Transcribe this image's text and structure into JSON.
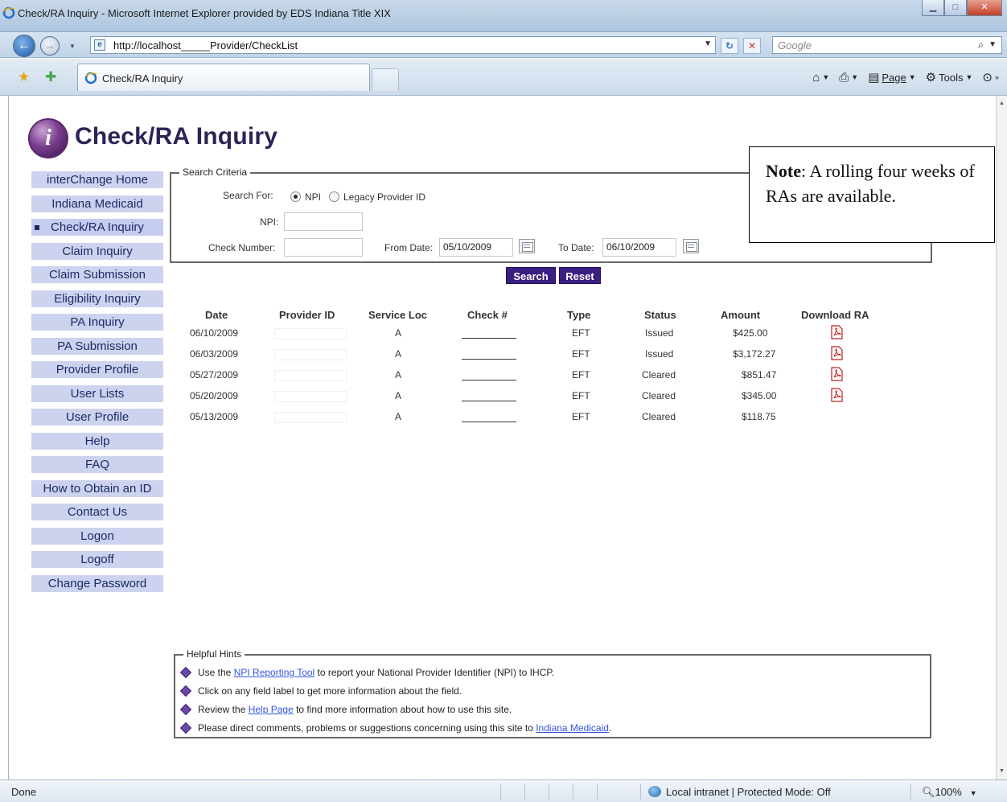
{
  "window": {
    "title": "Check/RA Inquiry - Microsoft Internet Explorer provided by EDS Indiana Title XIX"
  },
  "address_bar": {
    "url": "http://localhost_____Provider/CheckList",
    "search_placeholder": "Google"
  },
  "tab": {
    "label": "Check/RA Inquiry"
  },
  "command_bar": {
    "page_label": "Page",
    "tools_label": "Tools"
  },
  "page": {
    "heading": "Check/RA Inquiry",
    "logo_glyph": "i"
  },
  "nav": [
    {
      "label": "interChange Home"
    },
    {
      "label": "Indiana Medicaid"
    },
    {
      "label": "Check/RA Inquiry",
      "active": true
    },
    {
      "label": "Claim Inquiry"
    },
    {
      "label": "Claim Submission"
    },
    {
      "label": "Eligibility Inquiry"
    },
    {
      "label": "PA Inquiry"
    },
    {
      "label": "PA Submission"
    },
    {
      "label": "Provider Profile"
    },
    {
      "label": "User Lists"
    },
    {
      "label": "User Profile"
    },
    {
      "label": "Help"
    },
    {
      "label": "FAQ"
    },
    {
      "label": "How to Obtain an ID"
    },
    {
      "label": "Contact Us"
    },
    {
      "label": "Logon"
    },
    {
      "label": "Logoff"
    },
    {
      "label": "Change Password"
    }
  ],
  "search_criteria": {
    "legend": "Search Criteria",
    "search_for_label": "Search For:",
    "options": [
      {
        "label": "NPI",
        "selected": true
      },
      {
        "label": "Legacy Provider ID",
        "selected": false
      }
    ],
    "npi_label": "NPI:",
    "npi_value": "",
    "check_number_label": "Check Number:",
    "check_number_value": "",
    "from_date_label": "From Date:",
    "from_date_value": "05/10/2009",
    "to_date_label": "To Date:",
    "to_date_value": "06/10/2009"
  },
  "buttons": {
    "search": "Search",
    "reset": "Reset"
  },
  "results": {
    "columns": [
      "Date",
      "Provider ID",
      "Service Loc",
      "Check #",
      "Type",
      "Status",
      "Amount",
      "Download RA"
    ],
    "rows": [
      {
        "date": "06/10/2009",
        "service_loc": "A",
        "type": "EFT",
        "status": "Issued",
        "amount": "$425.00",
        "has_ra": true
      },
      {
        "date": "06/03/2009",
        "service_loc": "A",
        "type": "EFT",
        "status": "Issued",
        "amount": "$3,172.27",
        "has_ra": true
      },
      {
        "date": "05/27/2009",
        "service_loc": "A",
        "type": "EFT",
        "status": "Cleared",
        "amount": "$851.47",
        "has_ra": true
      },
      {
        "date": "05/20/2009",
        "service_loc": "A",
        "type": "EFT",
        "status": "Cleared",
        "amount": "$345.00",
        "has_ra": true
      },
      {
        "date": "05/13/2009",
        "service_loc": "A",
        "type": "EFT",
        "status": "Cleared",
        "amount": "$118.75",
        "has_ra": false
      }
    ]
  },
  "hints": {
    "legend": "Helpful Hints",
    "h1_pre": "Use the ",
    "h1_link": "NPI Reporting Tool",
    "h1_post": " to report your National Provider Identifier (NPI) to IHCP.",
    "h2": "Click on any field label to get more information about the field.",
    "h3_pre": "Review the ",
    "h3_link": "Help Page",
    "h3_post": " to find more information about how to use this site.",
    "h4_pre": "Please direct comments, problems or suggestions concerning using this site to ",
    "h4_link": "Indiana Medicaid",
    "h4_post": "."
  },
  "note": {
    "label": "Note",
    "text": ": A rolling four weeks of RAs are available."
  },
  "status_bar": {
    "left": "Done",
    "zone": "Local intranet | Protected Mode: Off",
    "zoom": "100%"
  },
  "colors": {
    "nav_bg": "#cdd3ee",
    "nav_text": "#1a2a66",
    "button_bg": "#3a1e80",
    "heading": "#2b2457",
    "link": "#3355dd"
  },
  "icons": [
    "ie-icon",
    "back-icon",
    "forward-icon",
    "page-icon",
    "refresh-icon",
    "stop-icon",
    "search-icon",
    "favorites-star-icon",
    "add-favorites-icon",
    "home-icon",
    "print-icon",
    "page-menu-icon",
    "tools-icon",
    "help-icon",
    "calendar-icon",
    "pdf-icon",
    "globe-icon",
    "zoom-icon"
  ]
}
